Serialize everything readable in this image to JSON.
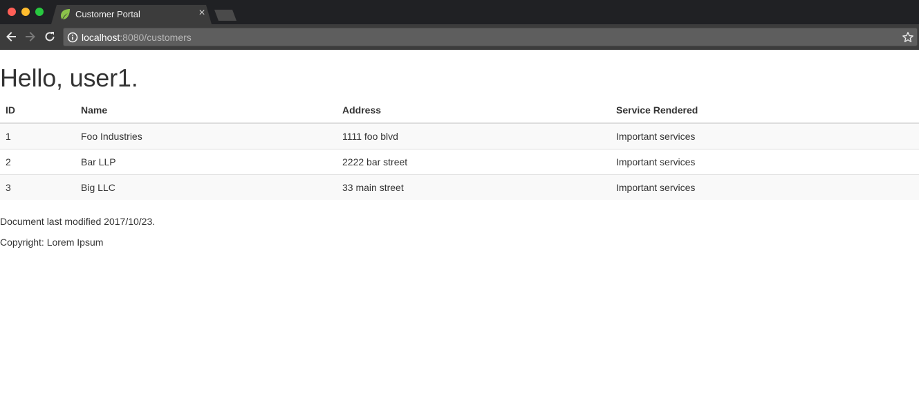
{
  "browser": {
    "tab_title": "Customer Portal",
    "tab_close": "×",
    "url_host": "localhost",
    "url_rest": ":8080/customers"
  },
  "page": {
    "greeting": "Hello, user1.",
    "table": {
      "headers": [
        "ID",
        "Name",
        "Address",
        "Service Rendered"
      ],
      "rows": [
        [
          "1",
          "Foo Industries",
          "1111 foo blvd",
          "Important services"
        ],
        [
          "2",
          "Bar LLP",
          "2222 bar street",
          "Important services"
        ],
        [
          "3",
          "Big LLC",
          "33 main street",
          "Important services"
        ]
      ]
    },
    "last_modified": "Document last modified 2017/10/23.",
    "copyright": "Copyright: Lorem Ipsum"
  },
  "colors": {
    "tabbar": "#202124",
    "toolbar": "#3c3c3c",
    "omnibox": "#5e5e5e",
    "favicon": "#8bc34a",
    "text": "#333333",
    "row_stripe": "#f9f9f9",
    "border": "#dddddd"
  },
  "icons": [
    "leaf-favicon-icon",
    "close-icon",
    "back-arrow-icon",
    "forward-arrow-icon",
    "reload-icon",
    "info-icon",
    "star-icon"
  ]
}
